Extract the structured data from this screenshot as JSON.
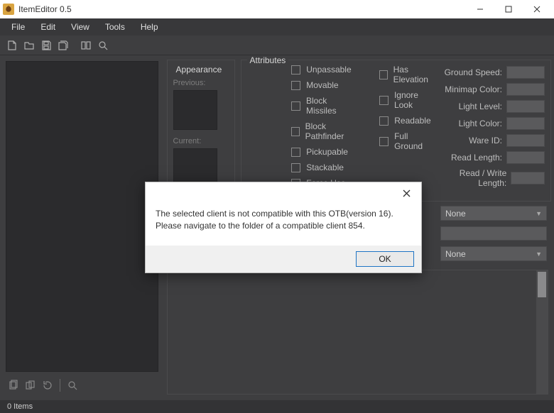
{
  "window": {
    "title": "ItemEditor 0.5"
  },
  "menu": {
    "file": "File",
    "edit": "Edit",
    "view": "View",
    "tools": "Tools",
    "help": "Help"
  },
  "appearance": {
    "title": "Appearance",
    "previous_label": "Previous:",
    "current_label": "Current:"
  },
  "attributes": {
    "title": "Attributes",
    "col1": {
      "unpassable": "Unpassable",
      "movable": "Movable",
      "block_missiles": "Block Missiles",
      "block_pathfinder": "Block Pathfinder",
      "pickupable": "Pickupable",
      "stackable": "Stackable",
      "force_use": "Force Use"
    },
    "col2": {
      "has_elevation": "Has Elevation",
      "ignore_look": "Ignore Look",
      "readable": "Readable",
      "full_ground": "Full Ground"
    },
    "fields": {
      "ground_speed": "Ground Speed:",
      "minimap_color": "Minimap Color:",
      "light_level": "Light Level:",
      "light_color": "Light Color:",
      "ware_id": "Ware ID:",
      "read_length": "Read Length:",
      "rw_length": "Read / Write Length:"
    },
    "lower": {
      "combo1": "None",
      "combo2": "None"
    }
  },
  "status": {
    "items": "0 Items"
  },
  "dialog": {
    "message": "The selected client is not compatible with this OTB(version 16). Please navigate to the folder of a compatible client 854.",
    "ok": "OK"
  }
}
